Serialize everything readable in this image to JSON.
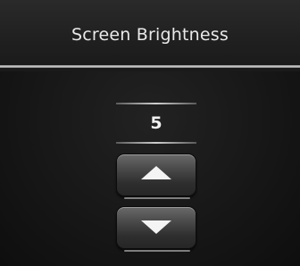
{
  "header": {
    "title": "Screen Brightness"
  },
  "brightness": {
    "value": "5"
  },
  "controls": {
    "increase_icon": "triangle-up-icon",
    "decrease_icon": "triangle-down-icon"
  },
  "colors": {
    "background": "#151515",
    "text": "#e9e9e9",
    "divider": "#cfcfcf"
  }
}
